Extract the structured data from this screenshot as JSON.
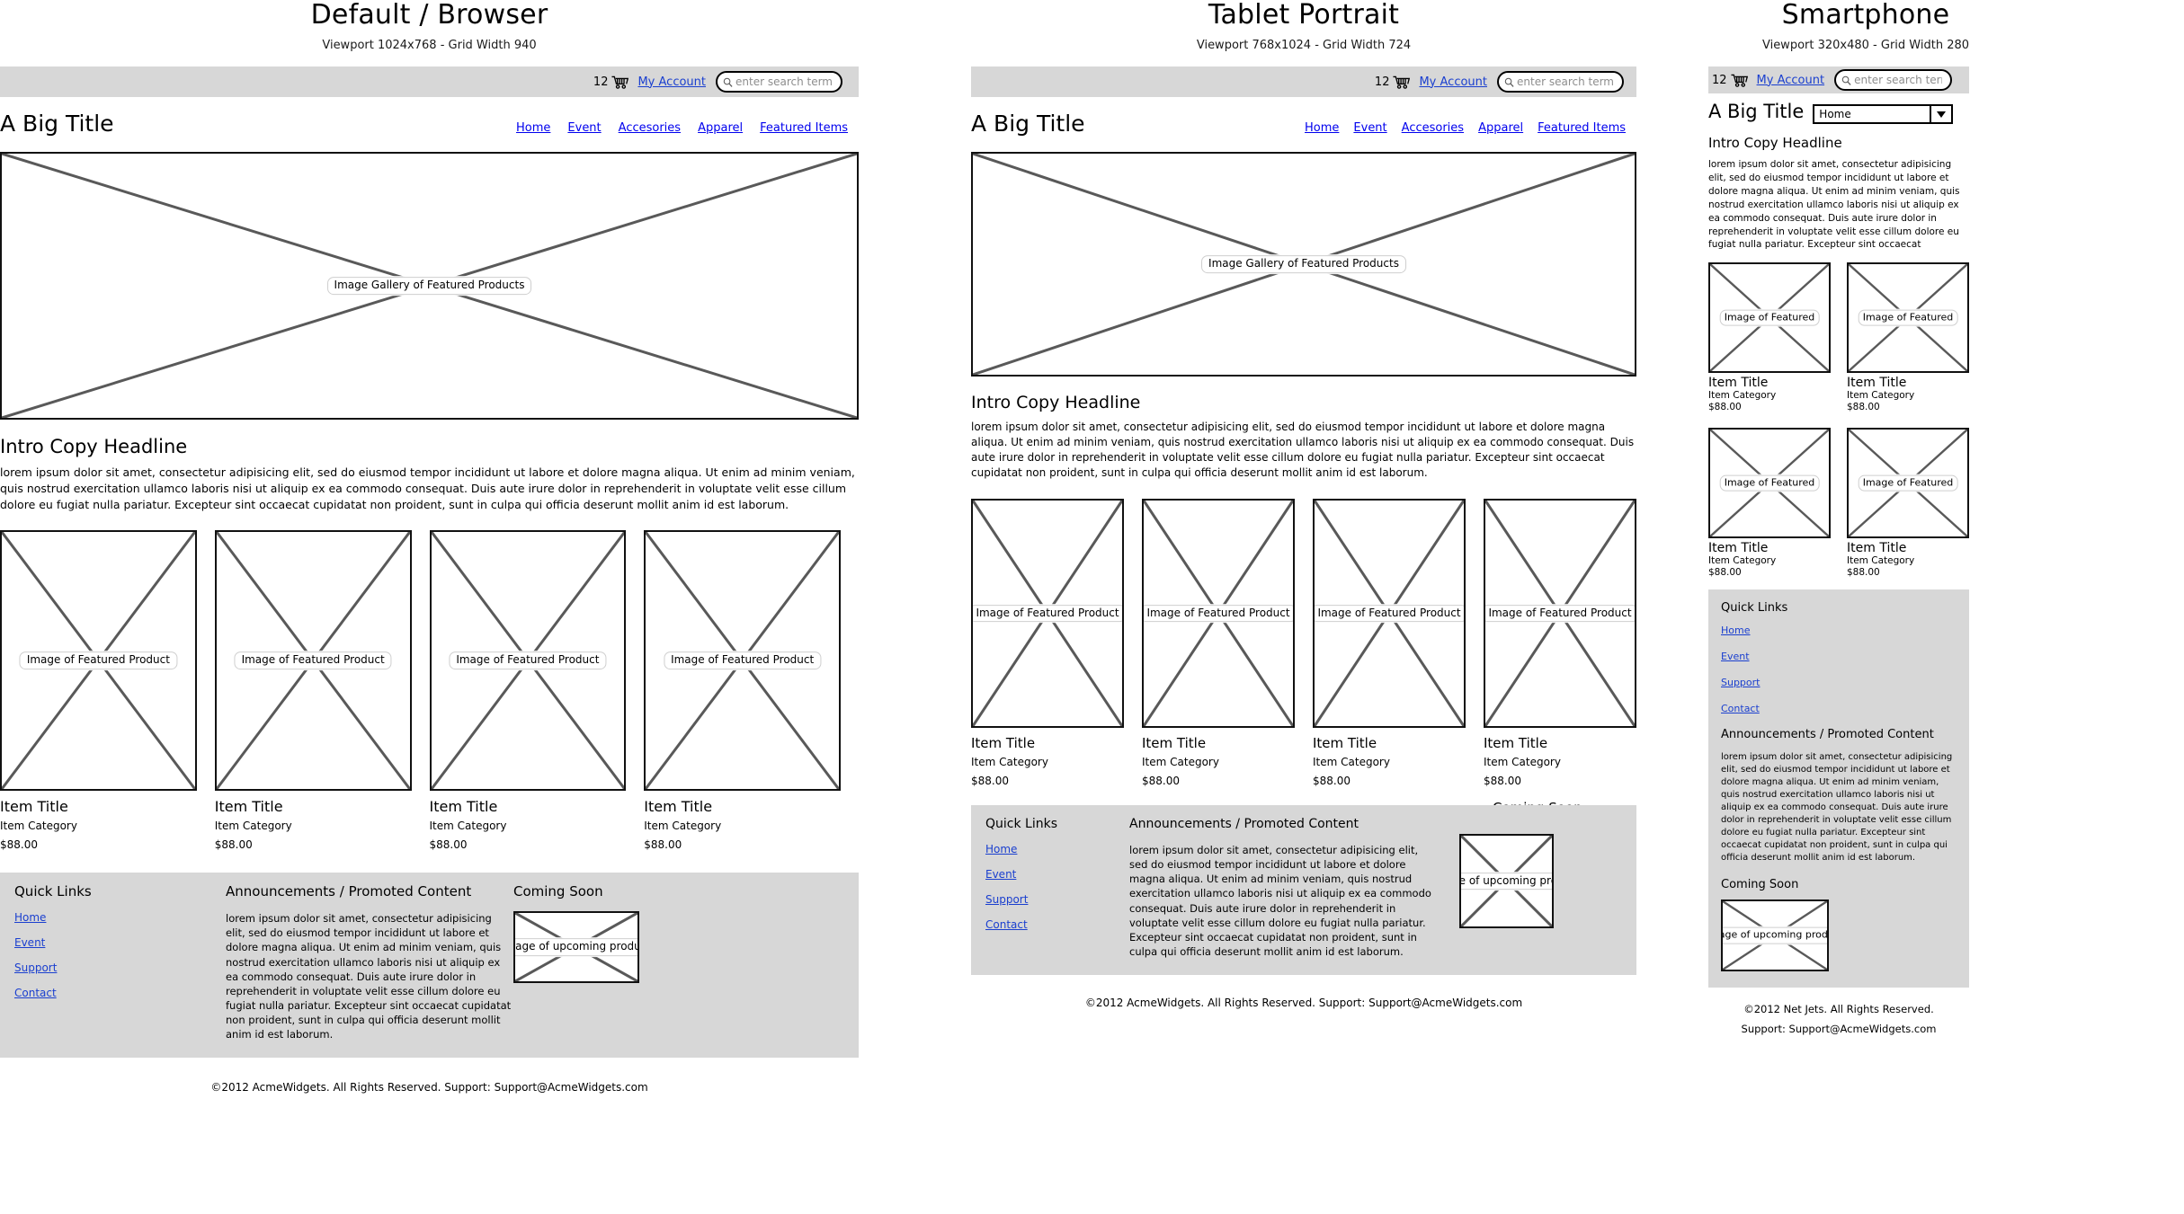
{
  "columns": [
    {
      "id": "desktop",
      "title": "Default / Browser",
      "subtitle": "Viewport 1024x768 - Grid Width 940"
    },
    {
      "id": "tablet",
      "title": "Tablet Portrait",
      "subtitle": "Viewport 768x1024 - Grid Width 724"
    },
    {
      "id": "smartphone",
      "title": "Smartphone",
      "subtitle": "Viewport 320x480 - Grid Width 280"
    }
  ],
  "utility": {
    "cart_count": "12",
    "cart_icon": "shopping-cart-icon",
    "account_label": "My Account",
    "search_icon": "magnifier-icon",
    "search_placeholder": "enter search terms",
    "search_value": ""
  },
  "brand": {
    "title": "A Big Title"
  },
  "nav": {
    "items": [
      "Home",
      "Event",
      "Accesories",
      "Apparel",
      "Featured Items"
    ],
    "mobile_selected": "Home",
    "mobile_dropdown_icon": "chevron-down-icon"
  },
  "hero": {
    "label": "Image Gallery of Featured Products"
  },
  "intro": {
    "headline": "Intro Copy Headline",
    "body_full": "lorem ipsum dolor sit amet, consectetur adipisicing elit, sed do eiusmod tempor incididunt ut labore et dolore magna aliqua. Ut enim ad minim veniam, quis nostrud exercitation ullamco laboris nisi ut aliquip ex ea commodo consequat. Duis aute irure dolor in reprehenderit in voluptate velit esse cillum dolore eu fugiat nulla pariatur. Excepteur sint occaecat cupidatat non proident, sunt in culpa qui officia deserunt mollit anim id est laborum.",
    "body_mobile": "lorem ipsum dolor sit amet, consectetur adipisicing elit, sed do eiusmod tempor incididunt ut labore et dolore magna aliqua. Ut enim ad minim veniam, quis nostrud exercitation ullamco laboris nisi ut aliquip ex ea commodo consequat. Duis aute irure dolor in reprehenderit in voluptate velit esse cillum dolore eu fugiat nulla pariatur. Excepteur sint occaecat"
  },
  "products": {
    "image_label_full": "Image of Featured Product",
    "image_label_short": "Image of Featured",
    "items": [
      {
        "title": "Item Title",
        "category": "Item Category",
        "price": "$88.00"
      },
      {
        "title": "Item Title",
        "category": "Item Category",
        "price": "$88.00"
      },
      {
        "title": "Item Title",
        "category": "Item Category",
        "price": "$88.00"
      },
      {
        "title": "Item Title",
        "category": "Item Category",
        "price": "$88.00"
      }
    ]
  },
  "footer": {
    "quick_links_head": "Quick Links",
    "quick_links": [
      "Home",
      "Event",
      "Support",
      "Contact"
    ],
    "announcements_head": "Announcements / Promoted Content",
    "announcements_body": "lorem ipsum dolor sit amet, consectetur adipisicing elit, sed do eiusmod tempor incididunt ut labore et dolore magna aliqua. Ut enim ad minim veniam, quis nostrud exercitation ullamco laboris nisi ut aliquip ex ea commodo consequat. Duis aute irure dolor in reprehenderit in voluptate velit esse cillum dolore eu fugiat nulla pariatur. Excepteur sint occaecat cupidatat non proident, sunt in culpa qui officia deserunt mollit anim id est laborum.",
    "coming_soon_head": "Coming Soon",
    "coming_soon_image_label": "Image of upcoming product"
  },
  "copyright": {
    "desktop": "©2012 AcmeWidgets.  All Rights Reserved.  Support: Support@AcmeWidgets.com",
    "tablet": "©2012 AcmeWidgets.  All Rights Reserved.  Support: Support@AcmeWidgets.com",
    "mobile_line1": "©2012 Net Jets.  All Rights Reserved.",
    "mobile_line2": "Support: Support@AcmeWidgets.com"
  },
  "colors": {
    "panel_gray": "#d7d7d7",
    "link_blue": "#1a3fcf",
    "outline_black": "#111111",
    "x_gray": "#595959"
  }
}
